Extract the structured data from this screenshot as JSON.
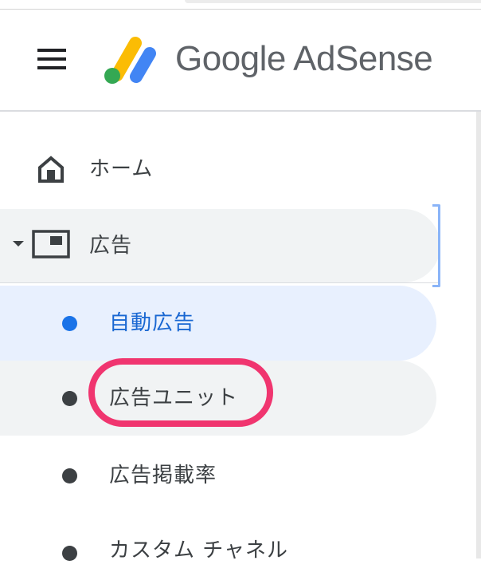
{
  "header": {
    "menu_icon": "hamburger-menu-icon",
    "logo_icon": "adsense-logo-icon",
    "brand": "Google AdSense",
    "logo_colors": {
      "yellow": "#fbbc04",
      "blue": "#4285f4",
      "green": "#34a853"
    }
  },
  "nav": {
    "home": {
      "label": "ホーム",
      "icon": "home-icon"
    },
    "ads": {
      "label": "広告",
      "icon": "ad-unit-icon",
      "caret_icon": "caret-down-icon",
      "expanded": true
    },
    "sub_items": [
      {
        "label": "自動広告",
        "selected": true
      },
      {
        "label": "広告ユニット",
        "selected": false,
        "hovered": true
      },
      {
        "label": "広告掲載率",
        "selected": false
      },
      {
        "label": "カスタム チャネル",
        "selected": false
      }
    ]
  },
  "colors": {
    "accent_blue": "#1a73e8",
    "selected_bg": "#e8f0fe",
    "hover_bg": "#f1f3f4",
    "annotation_pink": "#f0356f"
  },
  "annotation": {
    "target": "広告ユニット"
  }
}
